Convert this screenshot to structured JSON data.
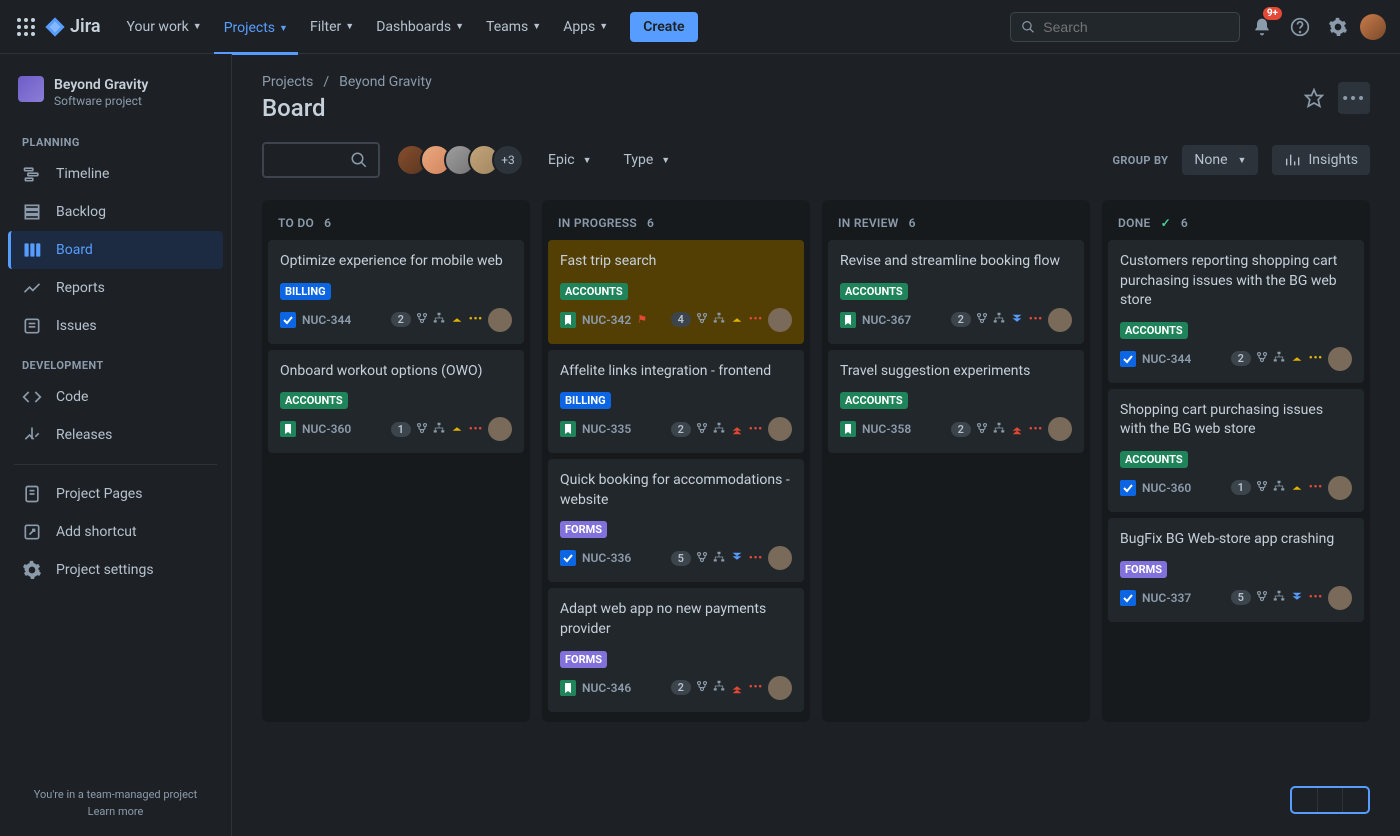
{
  "topnav": {
    "logo_text": "Jira",
    "links": [
      {
        "label": "Your work"
      },
      {
        "label": "Projects",
        "active": true
      },
      {
        "label": "Filter"
      },
      {
        "label": "Dashboards"
      },
      {
        "label": "Teams"
      },
      {
        "label": "Apps"
      }
    ],
    "create_label": "Create",
    "search_placeholder": "Search",
    "notification_badge": "9+"
  },
  "sidebar": {
    "project_name": "Beyond Gravity",
    "project_subtitle": "Software project",
    "groups": [
      {
        "label": "PLANNING",
        "items": [
          {
            "icon": "timeline",
            "label": "Timeline"
          },
          {
            "icon": "backlog",
            "label": "Backlog"
          },
          {
            "icon": "board",
            "label": "Board",
            "active": true
          },
          {
            "icon": "reports",
            "label": "Reports"
          },
          {
            "icon": "issues",
            "label": "Issues"
          }
        ]
      },
      {
        "label": "DEVELOPMENT",
        "items": [
          {
            "icon": "code",
            "label": "Code"
          },
          {
            "icon": "releases",
            "label": "Releases"
          }
        ]
      }
    ],
    "bottom_items": [
      {
        "icon": "page",
        "label": "Project Pages"
      },
      {
        "icon": "shortcut",
        "label": "Add shortcut"
      },
      {
        "icon": "settings",
        "label": "Project settings"
      }
    ],
    "footer_line1": "You're in a team-managed project",
    "footer_line2": "Learn more"
  },
  "breadcrumb": {
    "root": "Projects",
    "current": "Beyond Gravity"
  },
  "page_title": "Board",
  "toolbar": {
    "avatars_extra": "+3",
    "filters": [
      {
        "label": "Epic"
      },
      {
        "label": "Type"
      }
    ],
    "group_by_label": "GROUP BY",
    "group_by_value": "None",
    "insights_label": "Insights"
  },
  "columns": [
    {
      "name": "TO DO",
      "count": "6",
      "cards": [
        {
          "title": "Optimize experience for mobile web",
          "tag": "BILLING",
          "tagc": "billing",
          "type": "task",
          "key": "NUC-344",
          "count": "2",
          "prio": "med",
          "dots": "yellow"
        },
        {
          "title": "Onboard workout options (OWO)",
          "tag": "ACCOUNTS",
          "tagc": "accounts",
          "type": "story",
          "key": "NUC-360",
          "count": "1",
          "prio": "med",
          "dots": "red"
        }
      ]
    },
    {
      "name": "IN PROGRESS",
      "count": "6",
      "cards": [
        {
          "title": "Fast trip search",
          "tag": "ACCOUNTS",
          "tagc": "accounts",
          "type": "story",
          "key": "NUC-342",
          "count": "4",
          "flag": true,
          "prio": "med",
          "dots": "red",
          "hl": true
        },
        {
          "title": "Affelite links integration - frontend",
          "tag": "BILLING",
          "tagc": "billing",
          "type": "story",
          "key": "NUC-335",
          "count": "2",
          "prio": "highest",
          "dots": "red"
        },
        {
          "title": "Quick booking for accommodations - website",
          "tag": "FORMS",
          "tagc": "forms",
          "type": "task",
          "key": "NUC-336",
          "count": "5",
          "prio": "low",
          "dots": "red"
        },
        {
          "title": "Adapt web app no new payments provider",
          "tag": "FORMS",
          "tagc": "forms",
          "type": "story",
          "key": "NUC-346",
          "count": "2",
          "prio": "highest",
          "dots": "red"
        }
      ]
    },
    {
      "name": "IN REVIEW",
      "count": "6",
      "cards": [
        {
          "title": "Revise and streamline booking flow",
          "tag": "ACCOUNTS",
          "tagc": "accounts",
          "type": "story",
          "key": "NUC-367",
          "count": "2",
          "prio": "low",
          "dots": "red"
        },
        {
          "title": "Travel suggestion experiments",
          "tag": "ACCOUNTS",
          "tagc": "accounts",
          "type": "story",
          "key": "NUC-358",
          "count": "2",
          "prio": "highest",
          "dots": "red"
        }
      ]
    },
    {
      "name": "DONE",
      "count": "6",
      "done": true,
      "cards": [
        {
          "title": "Customers reporting shopping cart purchasing issues with the BG web store",
          "tag": "ACCOUNTS",
          "tagc": "accounts",
          "type": "task",
          "key": "NUC-344",
          "count": "2",
          "prio": "med",
          "dots": "yellow"
        },
        {
          "title": "Shopping cart purchasing issues with the BG web store",
          "tag": "ACCOUNTS",
          "tagc": "accounts",
          "type": "task",
          "key": "NUC-360",
          "count": "1",
          "prio": "med",
          "dots": "red"
        },
        {
          "title": "BugFix BG Web-store app crashing",
          "tag": "FORMS",
          "tagc": "forms",
          "type": "task",
          "key": "NUC-337",
          "count": "5",
          "prio": "low",
          "dots": "red"
        }
      ]
    }
  ]
}
